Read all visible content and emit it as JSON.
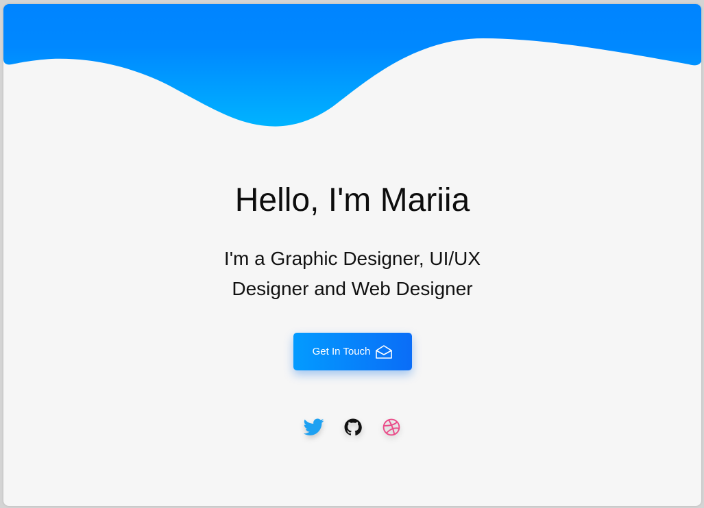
{
  "hero": {
    "headline": "Hello, I'm Mariia",
    "subtitle": "I'm a Graphic Designer, UI/UX Designer and Web Designer",
    "cta_label": "Get In Touch",
    "cta_icon": "envelope-open-icon"
  },
  "social": [
    {
      "name": "Twitter",
      "icon": "twitter-icon",
      "color": "#1da1f2"
    },
    {
      "name": "GitHub",
      "icon": "github-icon",
      "color": "#111111"
    },
    {
      "name": "Dribbble",
      "icon": "dribbble-icon",
      "color": "#ea4c89"
    }
  ],
  "theme": {
    "wave_top": "#0084ff",
    "wave_bottom": "#00b3ff",
    "background": "#f6f6f6",
    "button_start": "#039bff",
    "button_end": "#0a6df7"
  }
}
